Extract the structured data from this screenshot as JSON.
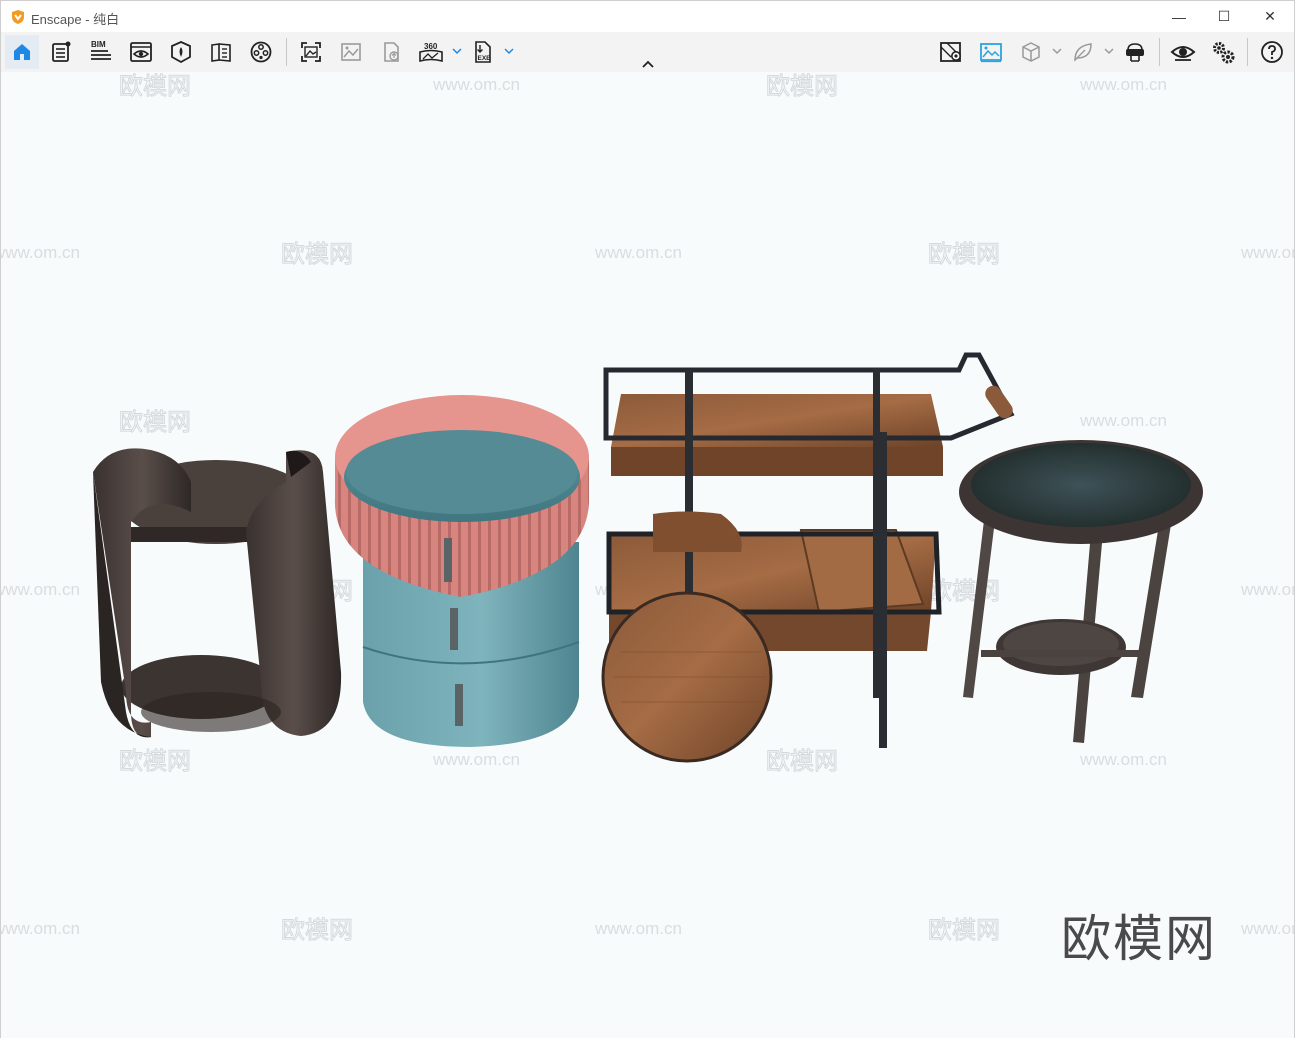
{
  "window": {
    "title": "Enscape - 纯白",
    "controls": {
      "minimize": "—",
      "maximize": "☐",
      "close": "✕"
    }
  },
  "toolbar": {
    "left_tools": [
      {
        "name": "home-icon",
        "active": true
      },
      {
        "name": "settings-list-icon"
      },
      {
        "name": "bim-icon",
        "label": "BIM"
      },
      {
        "name": "view-eye-icon"
      },
      {
        "name": "asset-library-icon"
      },
      {
        "name": "view-management-icon"
      },
      {
        "name": "video-editor-icon"
      },
      {
        "name": "screenshot-icon"
      },
      {
        "name": "batch-render-icon"
      },
      {
        "name": "upload-icon"
      },
      {
        "name": "panorama-icon",
        "label": "360"
      },
      {
        "name": "export-exe-icon",
        "label": "EXE"
      }
    ],
    "right_tools": [
      {
        "name": "map-pin-icon"
      },
      {
        "name": "rendering-mode-icon",
        "highlight_color": "#2aa3e0"
      },
      {
        "name": "cube-view-icon"
      },
      {
        "name": "leaf-icon"
      },
      {
        "name": "vr-headset-icon"
      },
      {
        "name": "visual-settings-icon"
      },
      {
        "name": "general-settings-icon"
      },
      {
        "name": "help-icon"
      }
    ]
  },
  "viewport": {
    "background_color": "#f8fbfc",
    "watermark_url": "www.om.cn",
    "watermark_brand": "欧模网",
    "brand_mark": "欧模网",
    "objects": [
      "side-table-wood-wrap",
      "round-drawer-cabinet",
      "bar-cart",
      "round-tray-table"
    ]
  },
  "colors": {
    "accent": "#1e88e5",
    "logo_orange": "#f29b20"
  }
}
